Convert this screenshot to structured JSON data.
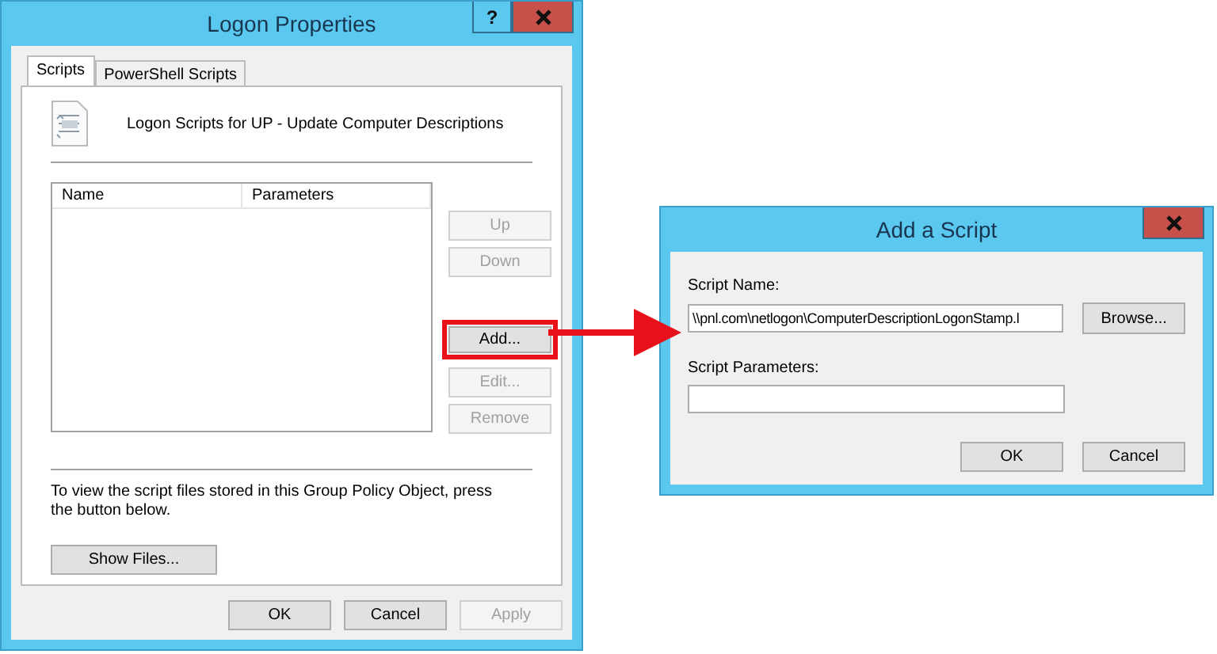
{
  "logon_window": {
    "title": "Logon Properties",
    "help_button": "?",
    "tabs": [
      {
        "label": "Scripts",
        "selected": true
      },
      {
        "label": "PowerShell Scripts",
        "selected": false
      }
    ],
    "heading": "Logon Scripts for UP - Update Computer Descriptions",
    "list_columns": [
      "Name",
      "Parameters"
    ],
    "side_buttons": [
      {
        "label": "Up",
        "disabled": true,
        "highlighted": false
      },
      {
        "label": "Down",
        "disabled": true,
        "highlighted": false
      },
      {
        "label": "Add...",
        "disabled": false,
        "highlighted": true
      },
      {
        "label": "Edit...",
        "disabled": true,
        "highlighted": false
      },
      {
        "label": "Remove",
        "disabled": true,
        "highlighted": false
      }
    ],
    "note": "To view the script files stored in this Group Policy Object, press the button below.",
    "show_files_button": "Show Files...",
    "footer_buttons": [
      {
        "label": "OK",
        "disabled": false
      },
      {
        "label": "Cancel",
        "disabled": false
      },
      {
        "label": "Apply",
        "disabled": true
      }
    ]
  },
  "add_script_window": {
    "title": "Add a Script",
    "fields": [
      {
        "label": "Script Name:",
        "value": "\\\\pnl.com\\netlogon\\ComputerDescriptionLogonStamp.l",
        "button": "Browse..."
      },
      {
        "label": "Script Parameters:"
      }
    ],
    "footer_buttons": [
      {
        "label": "OK",
        "disabled": false
      },
      {
        "label": "Cancel",
        "disabled": false
      }
    ]
  }
}
